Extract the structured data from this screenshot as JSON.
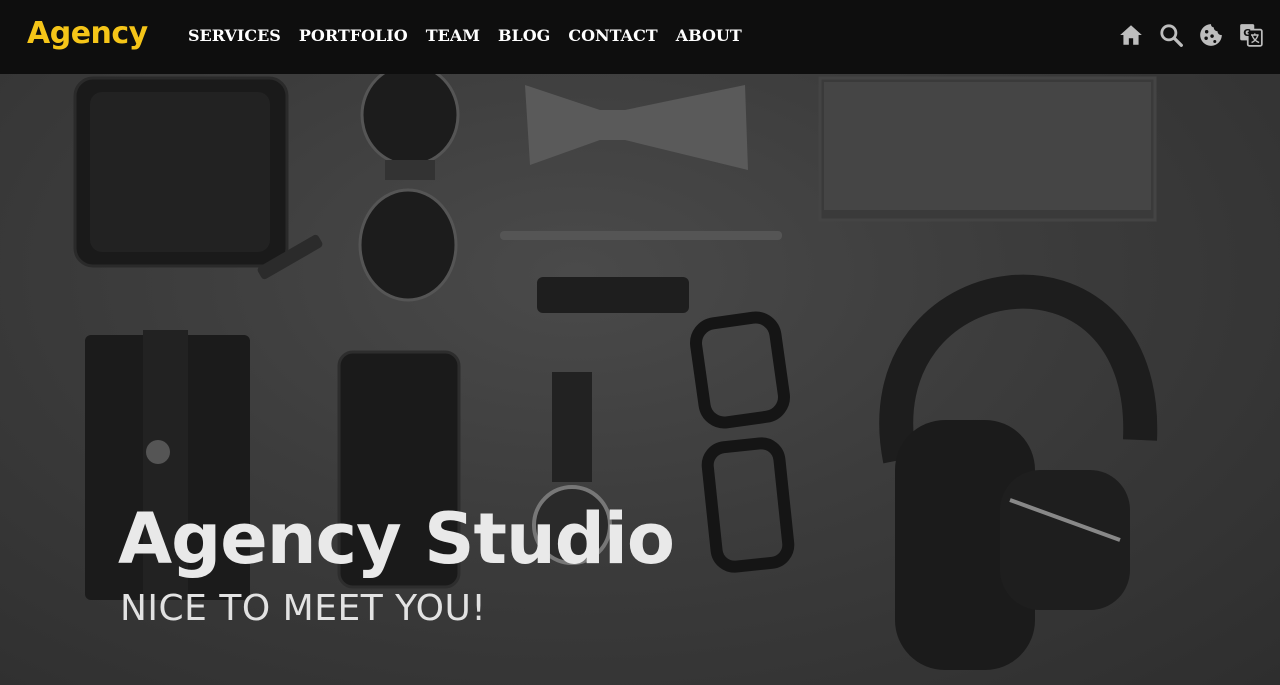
{
  "brand": {
    "name": "Agency",
    "color": "#f5c518"
  },
  "nav": {
    "items": [
      {
        "label": "SERVICES"
      },
      {
        "label": "PORTFOLIO"
      },
      {
        "label": "TEAM"
      },
      {
        "label": "BLOG"
      },
      {
        "label": "CONTACT"
      },
      {
        "label": "ABOUT"
      }
    ],
    "icons": [
      "home-icon",
      "search-icon",
      "cookie-icon",
      "translate-icon"
    ]
  },
  "hero": {
    "title": "Agency Studio",
    "subtitle": "NICE TO MEET YOU!"
  },
  "colors": {
    "navbar": "#0e0e0e",
    "accent": "#f5c518",
    "hero_text": "#e9e9e9"
  }
}
